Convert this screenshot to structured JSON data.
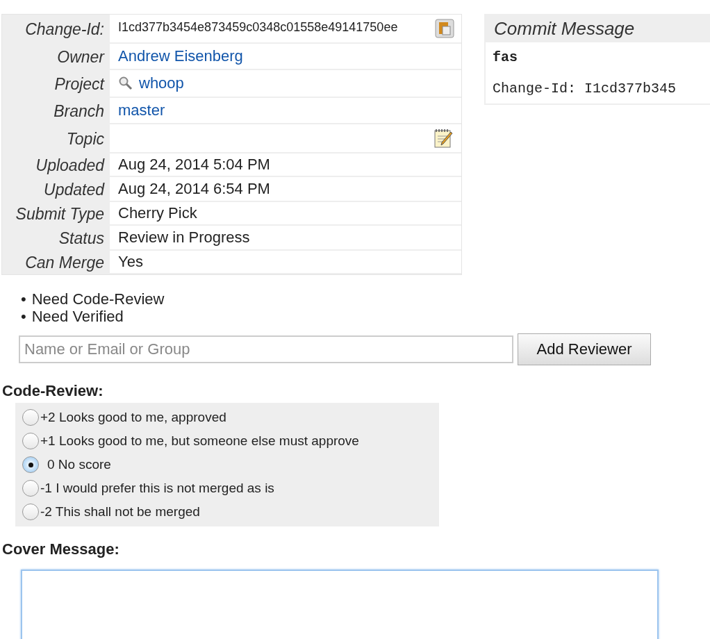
{
  "info_table": {
    "rows": [
      {
        "label": "Change-Id:",
        "kind": "id",
        "value": "I1cd377b3454e873459c0348c01558e49141750ee"
      },
      {
        "label": "Owner",
        "kind": "link",
        "value": "Andrew Eisenberg"
      },
      {
        "label": "Project",
        "kind": "project",
        "value": "whoop"
      },
      {
        "label": "Branch",
        "kind": "link",
        "value": "master"
      },
      {
        "label": "Topic",
        "kind": "topic"
      },
      {
        "label": "Uploaded",
        "kind": "text",
        "value": "Aug 24, 2014 5:04 PM"
      },
      {
        "label": "Updated",
        "kind": "text",
        "value": "Aug 24, 2014 6:54 PM"
      },
      {
        "label": "Submit Type",
        "kind": "text",
        "value": "Cherry Pick"
      },
      {
        "label": "Status",
        "kind": "text",
        "value": "Review in Progress"
      },
      {
        "label": "Can Merge",
        "kind": "text",
        "value": "Yes"
      }
    ]
  },
  "commit_message": {
    "title": "Commit Message",
    "subject": "fas",
    "footer": "Change-Id: I1cd377b345"
  },
  "needs": [
    {
      "bullet": "•",
      "label": "Need Code-Review"
    },
    {
      "bullet": "•",
      "label": "Need Verified"
    }
  ],
  "reviewer": {
    "placeholder": "Name or Email or Group",
    "button": "Add Reviewer"
  },
  "code_review": {
    "heading": "Code-Review:",
    "options": [
      {
        "label": "+2 Looks good to me, approved",
        "selected": false
      },
      {
        "label": "+1 Looks good to me, but someone else must approve",
        "selected": false
      },
      {
        "label": "0 No score",
        "selected": true
      },
      {
        "label": "-1 I would prefer this is not merged as is",
        "selected": false
      },
      {
        "label": "-2 This shall not be merged",
        "selected": false
      }
    ]
  },
  "cover_message": {
    "heading": "Cover Message:"
  }
}
